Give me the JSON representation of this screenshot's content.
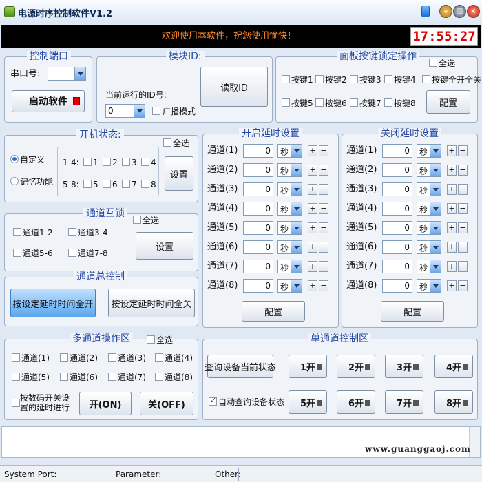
{
  "window": {
    "title": "电源时序控制软件V1.2"
  },
  "banner": {
    "welcome": "欢迎使用本软件，祝您使用愉快！",
    "clock": "17:55:27"
  },
  "port": {
    "title": "控制端口",
    "label": "串口号:",
    "start_label": "启动软件"
  },
  "module": {
    "title": "模块ID:",
    "id_label": "当前运行的ID号:",
    "id_value": "0",
    "broadcast": "广播模式",
    "read_label": "读取ID"
  },
  "panel": {
    "title": "面板按键锁定操作",
    "all": "全选",
    "all_open": "按键全开全关",
    "config": "配置",
    "keys": [
      "按键1",
      "按键2",
      "按键3",
      "按键4",
      "按键5",
      "按键6",
      "按键7",
      "按键8"
    ]
  },
  "power": {
    "title": "开机状态:",
    "all": "全选",
    "custom": "自定义",
    "memory": "记忆功能",
    "row1": "1-4:",
    "row2": "5-8:",
    "nums": [
      "1",
      "2",
      "3",
      "4",
      "5",
      "6",
      "7",
      "8"
    ],
    "set": "设置"
  },
  "interlock": {
    "title": "通道互锁",
    "all": "全选",
    "items": [
      "通道1-2",
      "通道3-4",
      "通道5-6",
      "通道7-8"
    ],
    "set": "设置"
  },
  "master": {
    "title": "通道总控制",
    "all_on": "按设定延时时间全开",
    "all_off": "按设定延时时间全关"
  },
  "multi": {
    "title": "多通道操作区",
    "all": "全选",
    "items": [
      "通道(1)",
      "通道(2)",
      "通道(3)",
      "通道(4)",
      "通道(5)",
      "通道(6)",
      "通道(7)",
      "通道(8)"
    ],
    "delay_note_1": "按数码开关设",
    "delay_note_2": "置的延时进行",
    "on": "开(ON)",
    "off": "关(OFF)"
  },
  "open_delay": {
    "title": "开启延时设置",
    "unit": "秒",
    "config": "配置",
    "channels": [
      "通道(1)",
      "通道(2)",
      "通道(3)",
      "通道(4)",
      "通道(5)",
      "通道(6)",
      "通道(7)",
      "通道(8)"
    ],
    "values": [
      "0",
      "0",
      "0",
      "0",
      "0",
      "0",
      "0",
      "0"
    ]
  },
  "close_delay": {
    "title": "关闭延时设置",
    "unit": "秒",
    "config": "配置",
    "channels": [
      "通道(1)",
      "通道(2)",
      "通道(3)",
      "通道(4)",
      "通道(5)",
      "通道(6)",
      "通道(7)",
      "通道(8)"
    ],
    "values": [
      "0",
      "0",
      "0",
      "0",
      "0",
      "0",
      "0",
      "0"
    ]
  },
  "single": {
    "title": "单通道控制区",
    "query": "查询设备当前状态",
    "auto_query": "自动查询设备状态",
    "buttons": [
      "1开",
      "2开",
      "3开",
      "4开",
      "5开",
      "6开",
      "7开",
      "8开"
    ]
  },
  "status": {
    "port": "System Port:",
    "param": "Parameter:",
    "other": "Other:"
  },
  "watermark": "www.guanggaoj.com",
  "colors": {
    "title_blue": "#2547a6",
    "clock_red": "#e00000",
    "banner_orange": "#ff8a2a"
  }
}
